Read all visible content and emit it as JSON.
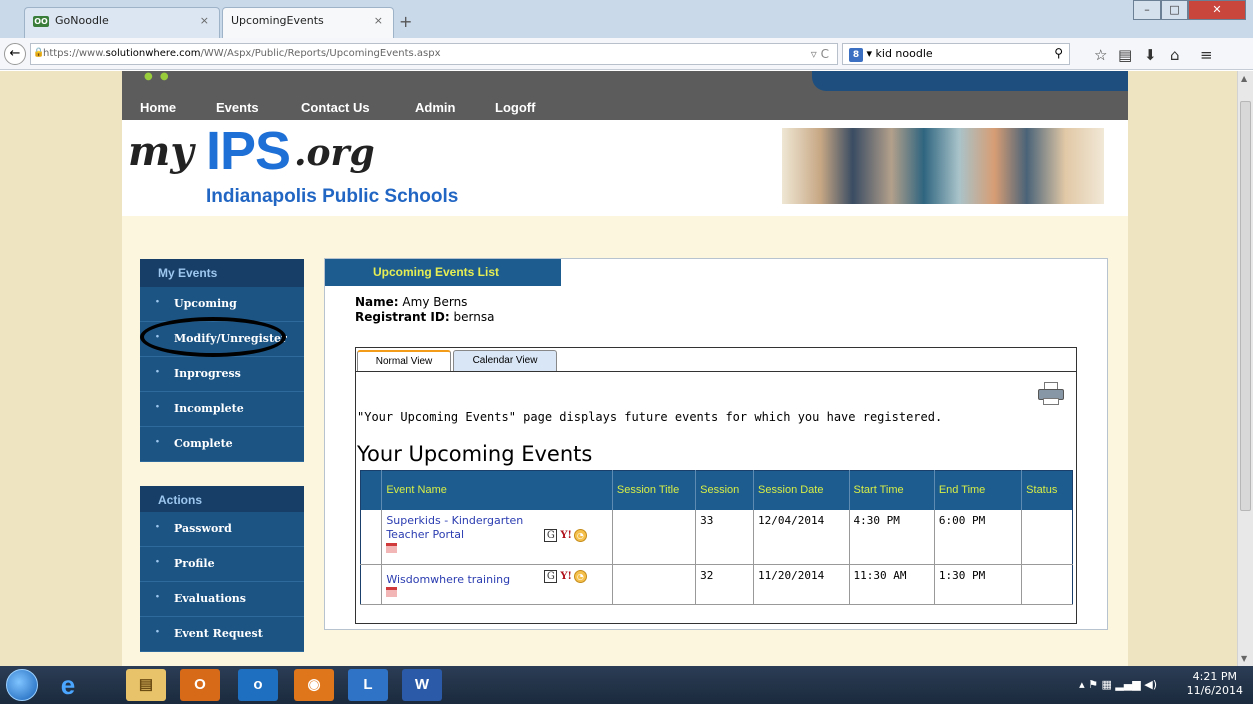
{
  "browser": {
    "tabs": [
      {
        "label": "GoNoodle",
        "favicon": "OO"
      },
      {
        "label": "UpcomingEvents"
      }
    ],
    "new_tab": "+",
    "url_prefix": "https://www.",
    "url_domain": "solutionwhere.com",
    "url_path": "/WW/Aspx/Public/Reports/UpcomingEvents.aspx",
    "search_engine_badge": "8",
    "search_value": "kid noodle"
  },
  "site": {
    "menu": [
      "Home",
      "Events",
      "Contact Us",
      "Admin",
      "Logoff"
    ],
    "logo_my": "my",
    "logo_ips": "IPS",
    "logo_org": ".org",
    "logo_sub": "Indianapolis Public Schools"
  },
  "sidebar": {
    "my_events_title": "My Events",
    "my_events": [
      "Upcoming",
      "Modify/Unregister",
      "Inprogress",
      "Incomplete",
      "Complete"
    ],
    "actions_title": "Actions",
    "actions": [
      "Password",
      "Profile",
      "Evaluations",
      "Event Request"
    ]
  },
  "main": {
    "tab_title": "Upcoming Events List",
    "name_label": "Name:",
    "name_value": "Amy Berns",
    "registrant_label": "Registrant ID:",
    "registrant_value": "bernsa",
    "view_tabs": [
      "Normal View",
      "Calendar View"
    ],
    "description": "\"Your Upcoming Events\" page displays future events for which you have registered.",
    "heading": "Your Upcoming Events",
    "columns": [
      "Event Name",
      "Session Title",
      "Session",
      "Session Date",
      "Start Time",
      "End Time",
      "Status"
    ],
    "rows": [
      {
        "event": "Superkids - Kindergarten Teacher Portal",
        "title": "",
        "session": "33",
        "date": "12/04/2014",
        "start": "4:30 PM",
        "end": "6:00 PM",
        "status": ""
      },
      {
        "event": "Wisdomwhere training",
        "title": "",
        "session": "32",
        "date": "11/20/2014",
        "start": "11:30 AM",
        "end": "1:30 PM",
        "status": ""
      }
    ],
    "icon_g": "G",
    "icon_y": "Y!"
  },
  "taskbar": {
    "apps": [
      "e",
      "▤",
      "O",
      "o",
      "◉",
      "L",
      "W"
    ],
    "time": "4:21 PM",
    "date": "11/6/2014"
  }
}
